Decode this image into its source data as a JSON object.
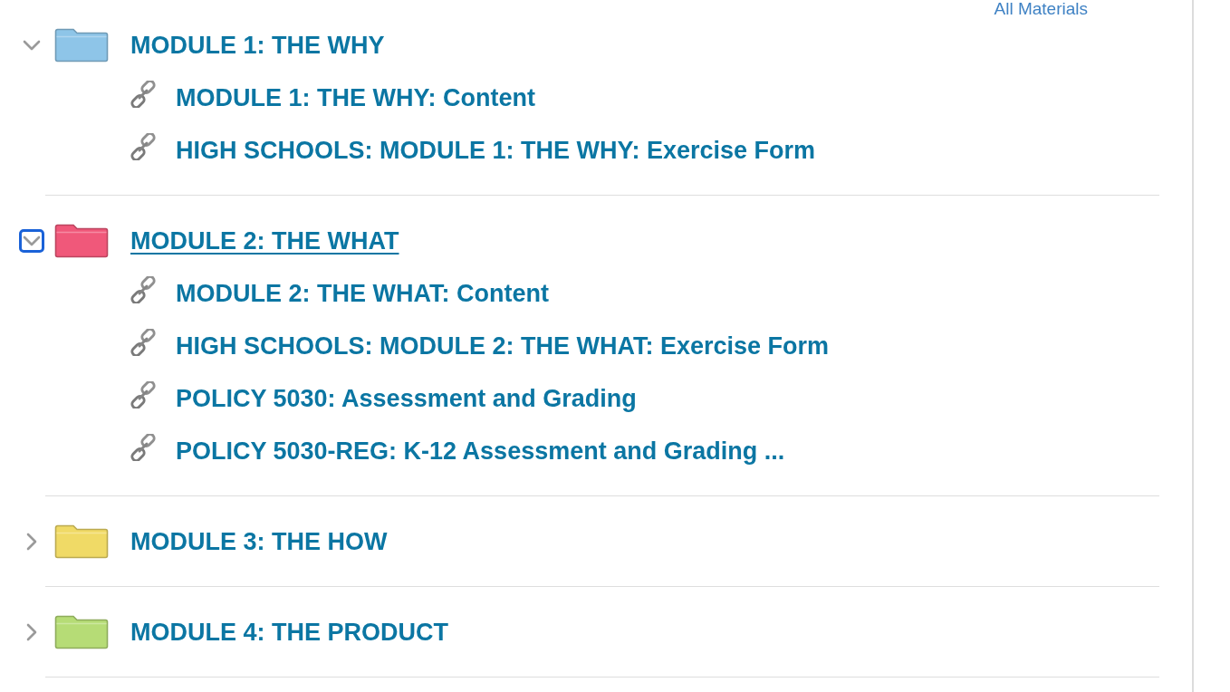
{
  "header": {
    "link": "All Materials"
  },
  "modules": [
    {
      "title": "MODULE 1: THE WHY",
      "expanded": true,
      "focused": false,
      "color": "#8ec5e8",
      "items": [
        {
          "title": "MODULE 1: THE WHY: Content"
        },
        {
          "title": "HIGH SCHOOLS: MODULE 1: THE WHY: Exercise Form"
        }
      ]
    },
    {
      "title": "MODULE 2: THE WHAT",
      "expanded": true,
      "focused": true,
      "color": "#f0587a",
      "items": [
        {
          "title": "MODULE 2: THE WHAT: Content"
        },
        {
          "title": "HIGH SCHOOLS: MODULE 2: THE WHAT: Exercise Form"
        },
        {
          "title": "POLICY 5030: Assessment and Grading"
        },
        {
          "title": "POLICY 5030-REG: K-12 Assessment and Grading ..."
        }
      ]
    },
    {
      "title": "MODULE 3: THE HOW",
      "expanded": false,
      "focused": false,
      "color": "#f0da66"
    },
    {
      "title": "MODULE 4: THE PRODUCT",
      "expanded": false,
      "focused": false,
      "color": "#b6dc76"
    }
  ]
}
